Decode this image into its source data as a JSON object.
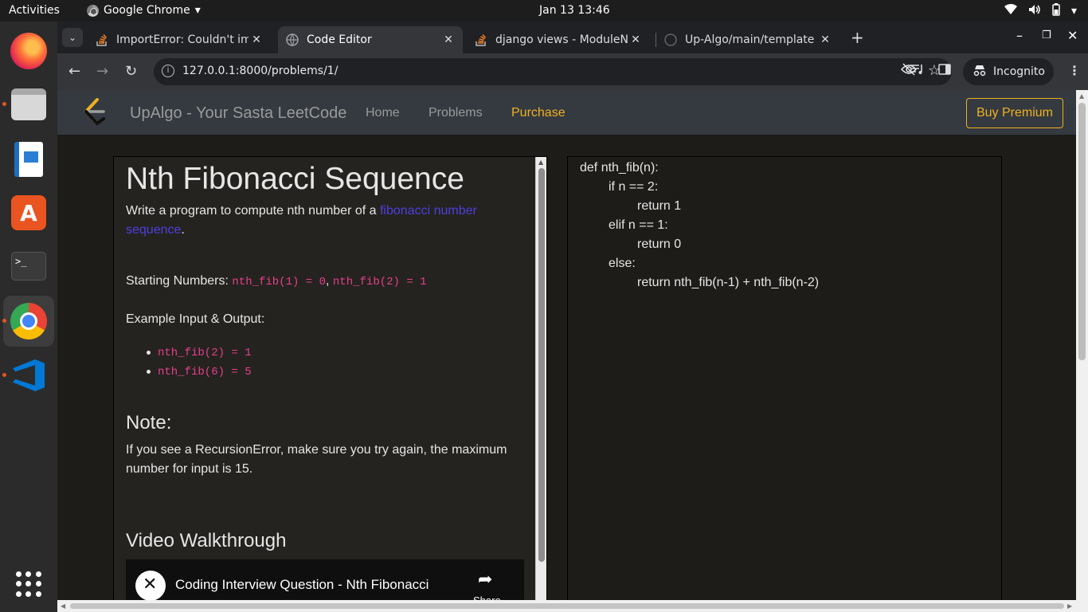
{
  "system": {
    "activities": "Activities",
    "app_name": "Google Chrome",
    "clock": "Jan 13  13:46"
  },
  "dock": {
    "apps": [
      "firefox",
      "files",
      "libreoffice-writer",
      "app-center",
      "terminal",
      "google-chrome",
      "vscode",
      "show-apps"
    ]
  },
  "browser": {
    "tabs": [
      {
        "title": "ImportError: Couldn't im",
        "active": false
      },
      {
        "title": "Code Editor",
        "active": true
      },
      {
        "title": "django views - ModuleNo",
        "active": false
      },
      {
        "title": "Up-Algo/main/template",
        "active": false
      }
    ],
    "url": "127.0.0.1:8000/problems/1/",
    "incognito_label": "Incognito"
  },
  "site": {
    "brand": "UpAlgo - Your Sasta LeetCode",
    "nav": [
      "Home",
      "Problems",
      "Purchase"
    ],
    "premium_button": "Buy Premium",
    "accent_color": "#f0b020"
  },
  "problem": {
    "title": "Nth Fibonacci Sequence",
    "intro_prefix": "Write a program to compute nth number of a ",
    "intro_link": "fibonacci number sequence",
    "intro_suffix": ".",
    "starting_label": "Starting Numbers: ",
    "starting_code_1": "nth_fib(1) = 0",
    "starting_sep": ", ",
    "starting_code_2": "nth_fib(2) = 1",
    "example_label": "Example Input & Output:",
    "examples": [
      "nth_fib(2) = 1",
      "nth_fib(6) = 5"
    ],
    "note_heading": "Note:",
    "note_text": "If you see a RecursionError, make sure you try again, the maximum number for input is 15.",
    "video_heading": "Video Walkthrough",
    "video_title": "Coding Interview Question - Nth Fibonacci",
    "video_share": "Share"
  },
  "editor": {
    "lines": [
      "def nth_fib(n):",
      "if n == 2:",
      "return 1",
      "elif n == 1:",
      "return 0",
      "else:",
      "return nth_fib(n-1) + nth_fib(n-2)"
    ],
    "indents": [
      0,
      1,
      2,
      1,
      2,
      1,
      2
    ]
  }
}
